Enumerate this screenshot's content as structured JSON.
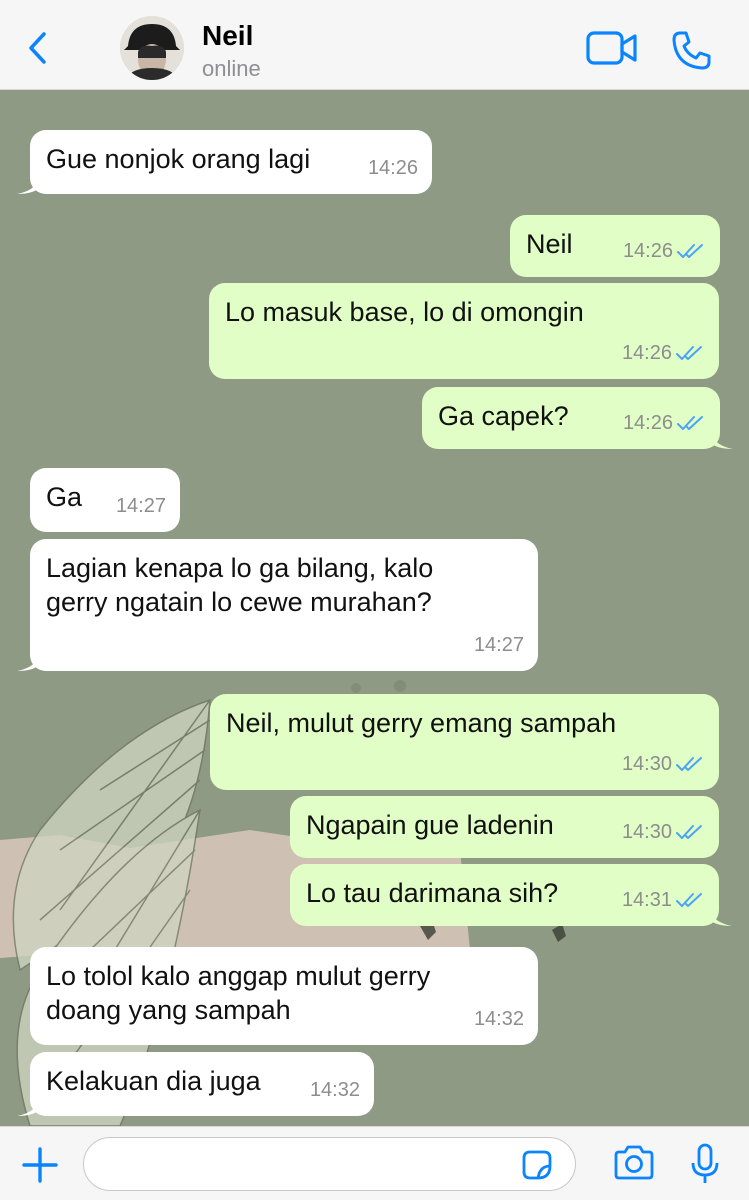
{
  "header": {
    "back_icon": "chevron-left-icon",
    "contact_name": "Neil",
    "contact_status": "online",
    "video_icon": "video-camera-icon",
    "call_icon": "phone-icon",
    "accent_color": "#0a84ff"
  },
  "messages": [
    {
      "direction": "incoming",
      "text": "Gue nonjok orang lagi",
      "time": "14:26",
      "read": false
    },
    {
      "direction": "outgoing",
      "text": "Neil",
      "time": "14:26",
      "read": true
    },
    {
      "direction": "outgoing",
      "text": "Lo masuk base, lo di omongin",
      "time": "14:26",
      "read": true
    },
    {
      "direction": "outgoing",
      "text": "Ga capek?",
      "time": "14:26",
      "read": true
    },
    {
      "direction": "incoming",
      "text": "Ga",
      "time": "14:27",
      "read": false
    },
    {
      "direction": "incoming",
      "text": "Lagian kenapa lo ga bilang, kalo\ngerry ngatain lo cewe murahan?",
      "time": "14:27",
      "read": false
    },
    {
      "direction": "outgoing",
      "text": "Neil, mulut gerry emang sampah",
      "time": "14:30",
      "read": true
    },
    {
      "direction": "outgoing",
      "text": "Ngapain gue ladenin",
      "time": "14:30",
      "read": true
    },
    {
      "direction": "outgoing",
      "text": "Lo tau darimana sih?",
      "time": "14:31",
      "read": true
    },
    {
      "direction": "incoming",
      "text": "Lo tolol kalo anggap mulut gerry\ndoang yang sampah",
      "time": "14:32",
      "read": false
    },
    {
      "direction": "incoming",
      "text": "Kelakuan dia juga",
      "time": "14:32",
      "read": false
    }
  ],
  "input_bar": {
    "add_icon": "plus-icon",
    "message_value": "",
    "sticker_icon": "sticker-icon",
    "camera_icon": "camera-icon",
    "mic_icon": "microphone-icon"
  },
  "colors": {
    "chat_background": "#8f9a84",
    "incoming_bubble": "#ffffff",
    "outgoing_bubble": "#e1fec6",
    "read_ticks": "#4aa3f5"
  }
}
